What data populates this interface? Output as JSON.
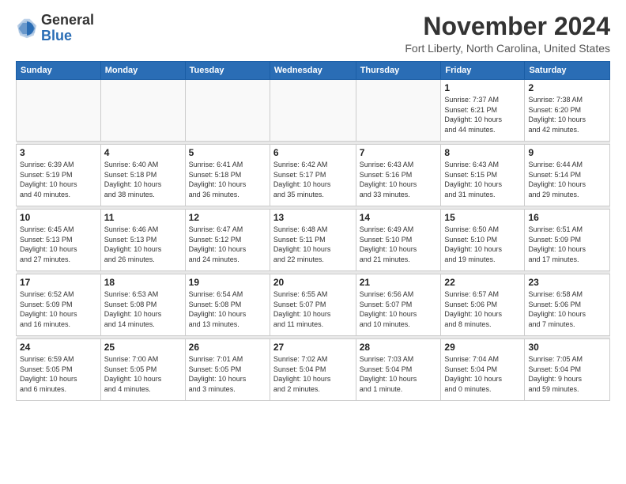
{
  "logo": {
    "general": "General",
    "blue": "Blue"
  },
  "title": "November 2024",
  "location": "Fort Liberty, North Carolina, United States",
  "weekdays": [
    "Sunday",
    "Monday",
    "Tuesday",
    "Wednesday",
    "Thursday",
    "Friday",
    "Saturday"
  ],
  "weeks": [
    [
      {
        "day": "",
        "info": ""
      },
      {
        "day": "",
        "info": ""
      },
      {
        "day": "",
        "info": ""
      },
      {
        "day": "",
        "info": ""
      },
      {
        "day": "",
        "info": ""
      },
      {
        "day": "1",
        "info": "Sunrise: 7:37 AM\nSunset: 6:21 PM\nDaylight: 10 hours\nand 44 minutes."
      },
      {
        "day": "2",
        "info": "Sunrise: 7:38 AM\nSunset: 6:20 PM\nDaylight: 10 hours\nand 42 minutes."
      }
    ],
    [
      {
        "day": "3",
        "info": "Sunrise: 6:39 AM\nSunset: 5:19 PM\nDaylight: 10 hours\nand 40 minutes."
      },
      {
        "day": "4",
        "info": "Sunrise: 6:40 AM\nSunset: 5:18 PM\nDaylight: 10 hours\nand 38 minutes."
      },
      {
        "day": "5",
        "info": "Sunrise: 6:41 AM\nSunset: 5:18 PM\nDaylight: 10 hours\nand 36 minutes."
      },
      {
        "day": "6",
        "info": "Sunrise: 6:42 AM\nSunset: 5:17 PM\nDaylight: 10 hours\nand 35 minutes."
      },
      {
        "day": "7",
        "info": "Sunrise: 6:43 AM\nSunset: 5:16 PM\nDaylight: 10 hours\nand 33 minutes."
      },
      {
        "day": "8",
        "info": "Sunrise: 6:43 AM\nSunset: 5:15 PM\nDaylight: 10 hours\nand 31 minutes."
      },
      {
        "day": "9",
        "info": "Sunrise: 6:44 AM\nSunset: 5:14 PM\nDaylight: 10 hours\nand 29 minutes."
      }
    ],
    [
      {
        "day": "10",
        "info": "Sunrise: 6:45 AM\nSunset: 5:13 PM\nDaylight: 10 hours\nand 27 minutes."
      },
      {
        "day": "11",
        "info": "Sunrise: 6:46 AM\nSunset: 5:13 PM\nDaylight: 10 hours\nand 26 minutes."
      },
      {
        "day": "12",
        "info": "Sunrise: 6:47 AM\nSunset: 5:12 PM\nDaylight: 10 hours\nand 24 minutes."
      },
      {
        "day": "13",
        "info": "Sunrise: 6:48 AM\nSunset: 5:11 PM\nDaylight: 10 hours\nand 22 minutes."
      },
      {
        "day": "14",
        "info": "Sunrise: 6:49 AM\nSunset: 5:10 PM\nDaylight: 10 hours\nand 21 minutes."
      },
      {
        "day": "15",
        "info": "Sunrise: 6:50 AM\nSunset: 5:10 PM\nDaylight: 10 hours\nand 19 minutes."
      },
      {
        "day": "16",
        "info": "Sunrise: 6:51 AM\nSunset: 5:09 PM\nDaylight: 10 hours\nand 17 minutes."
      }
    ],
    [
      {
        "day": "17",
        "info": "Sunrise: 6:52 AM\nSunset: 5:09 PM\nDaylight: 10 hours\nand 16 minutes."
      },
      {
        "day": "18",
        "info": "Sunrise: 6:53 AM\nSunset: 5:08 PM\nDaylight: 10 hours\nand 14 minutes."
      },
      {
        "day": "19",
        "info": "Sunrise: 6:54 AM\nSunset: 5:08 PM\nDaylight: 10 hours\nand 13 minutes."
      },
      {
        "day": "20",
        "info": "Sunrise: 6:55 AM\nSunset: 5:07 PM\nDaylight: 10 hours\nand 11 minutes."
      },
      {
        "day": "21",
        "info": "Sunrise: 6:56 AM\nSunset: 5:07 PM\nDaylight: 10 hours\nand 10 minutes."
      },
      {
        "day": "22",
        "info": "Sunrise: 6:57 AM\nSunset: 5:06 PM\nDaylight: 10 hours\nand 8 minutes."
      },
      {
        "day": "23",
        "info": "Sunrise: 6:58 AM\nSunset: 5:06 PM\nDaylight: 10 hours\nand 7 minutes."
      }
    ],
    [
      {
        "day": "24",
        "info": "Sunrise: 6:59 AM\nSunset: 5:05 PM\nDaylight: 10 hours\nand 6 minutes."
      },
      {
        "day": "25",
        "info": "Sunrise: 7:00 AM\nSunset: 5:05 PM\nDaylight: 10 hours\nand 4 minutes."
      },
      {
        "day": "26",
        "info": "Sunrise: 7:01 AM\nSunset: 5:05 PM\nDaylight: 10 hours\nand 3 minutes."
      },
      {
        "day": "27",
        "info": "Sunrise: 7:02 AM\nSunset: 5:04 PM\nDaylight: 10 hours\nand 2 minutes."
      },
      {
        "day": "28",
        "info": "Sunrise: 7:03 AM\nSunset: 5:04 PM\nDaylight: 10 hours\nand 1 minute."
      },
      {
        "day": "29",
        "info": "Sunrise: 7:04 AM\nSunset: 5:04 PM\nDaylight: 10 hours\nand 0 minutes."
      },
      {
        "day": "30",
        "info": "Sunrise: 7:05 AM\nSunset: 5:04 PM\nDaylight: 9 hours\nand 59 minutes."
      }
    ]
  ]
}
